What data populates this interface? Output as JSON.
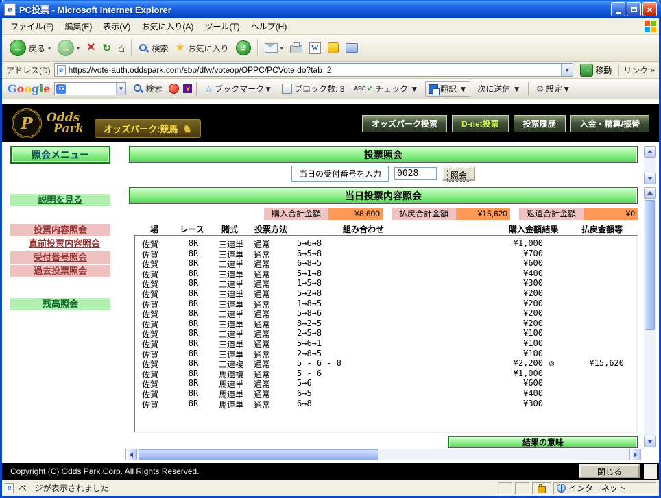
{
  "window": {
    "title": "PC投票 - Microsoft Internet Explorer"
  },
  "menubar": {
    "items": [
      "ファイル(F)",
      "編集(E)",
      "表示(V)",
      "お気に入り(A)",
      "ツール(T)",
      "ヘルプ(H)"
    ]
  },
  "toolbar": {
    "back": "戻る",
    "search": "検索",
    "favorites": "お気に入り"
  },
  "addressbar": {
    "label": "アドレス(D)",
    "url": "https://vote-auth.oddspark.com/sbp/dfw/voteop/OPPC/PCVote.do?tab=2",
    "go": "移動",
    "links": "リンク",
    "links_chevron": "»"
  },
  "googlebar": {
    "logo": "Google",
    "search": "検索",
    "bookmarks": "ブックマーク▼",
    "blocked": "ブロック数: 3",
    "check": "チェック ▼",
    "translate": "翻訳 ▼",
    "send": "次に送信 ▼",
    "settings": "設定▼"
  },
  "siteheader": {
    "brand_top": "Odds",
    "brand_bottom": "Park",
    "brand_initial": "P",
    "tagline": "オッズパーク:競馬",
    "nav": [
      "オッズパーク投票",
      "D-net投票",
      "投票履歴",
      "入金・精算/振替"
    ]
  },
  "sidebar": {
    "title": "照会メニュー",
    "help": "説明を見る",
    "links": [
      "投票内容照会",
      "直前投票内容照会",
      "受付番号照会",
      "過去投票照会"
    ],
    "balance": "残高照会"
  },
  "vote_inquiry": {
    "title": "投票照会",
    "input_label": "当日の受付番号を入力",
    "input_value": "0028",
    "submit": "照会"
  },
  "today": {
    "title": "当日投票内容照会",
    "summary": [
      {
        "label": "購入合計金額",
        "value": "¥8,600"
      },
      {
        "label": "払戻合計金額",
        "value": "¥15,620"
      },
      {
        "label": "返還合計金額",
        "value": "¥0"
      }
    ],
    "columns": [
      "場",
      "レース",
      "賭式",
      "投票方法",
      "組み合わせ",
      "購入金額",
      "結果",
      "払戻金額等"
    ],
    "rows": [
      {
        "place": "佐賀",
        "race": "8R",
        "type": "三連単",
        "method": "通常",
        "combo": "5→6→8",
        "amount": "¥1,000",
        "result": "",
        "payout": ""
      },
      {
        "place": "佐賀",
        "race": "8R",
        "type": "三連単",
        "method": "通常",
        "combo": "6→5→8",
        "amount": "¥700",
        "result": "",
        "payout": ""
      },
      {
        "place": "佐賀",
        "race": "8R",
        "type": "三連単",
        "method": "通常",
        "combo": "6→8→5",
        "amount": "¥600",
        "result": "",
        "payout": ""
      },
      {
        "place": "佐賀",
        "race": "8R",
        "type": "三連単",
        "method": "通常",
        "combo": "5→1→8",
        "amount": "¥400",
        "result": "",
        "payout": ""
      },
      {
        "place": "佐賀",
        "race": "8R",
        "type": "三連単",
        "method": "通常",
        "combo": "1→5→8",
        "amount": "¥300",
        "result": "",
        "payout": ""
      },
      {
        "place": "佐賀",
        "race": "8R",
        "type": "三連単",
        "method": "通常",
        "combo": "5→2→8",
        "amount": "¥200",
        "result": "",
        "payout": ""
      },
      {
        "place": "佐賀",
        "race": "8R",
        "type": "三連単",
        "method": "通常",
        "combo": "1→8→5",
        "amount": "¥200",
        "result": "",
        "payout": ""
      },
      {
        "place": "佐賀",
        "race": "8R",
        "type": "三連単",
        "method": "通常",
        "combo": "5→8→6",
        "amount": "¥200",
        "result": "",
        "payout": ""
      },
      {
        "place": "佐賀",
        "race": "8R",
        "type": "三連単",
        "method": "通常",
        "combo": "8→2→5",
        "amount": "¥200",
        "result": "",
        "payout": ""
      },
      {
        "place": "佐賀",
        "race": "8R",
        "type": "三連単",
        "method": "通常",
        "combo": "2→5→8",
        "amount": "¥100",
        "result": "",
        "payout": ""
      },
      {
        "place": "佐賀",
        "race": "8R",
        "type": "三連単",
        "method": "通常",
        "combo": "5→6→1",
        "amount": "¥100",
        "result": "",
        "payout": ""
      },
      {
        "place": "佐賀",
        "race": "8R",
        "type": "三連単",
        "method": "通常",
        "combo": "2→8→5",
        "amount": "¥100",
        "result": "",
        "payout": ""
      },
      {
        "place": "佐賀",
        "race": "8R",
        "type": "三連複",
        "method": "通常",
        "combo": "5 - 6 - 8",
        "amount": "¥2,200",
        "result": "◎",
        "payout": "¥15,620"
      },
      {
        "place": "佐賀",
        "race": "8R",
        "type": "馬連複",
        "method": "通常",
        "combo": "5 - 6",
        "amount": "¥1,000",
        "result": "",
        "payout": ""
      },
      {
        "place": "佐賀",
        "race": "8R",
        "type": "馬連単",
        "method": "通常",
        "combo": "5→6",
        "amount": "¥600",
        "result": "",
        "payout": ""
      },
      {
        "place": "佐賀",
        "race": "8R",
        "type": "馬連単",
        "method": "通常",
        "combo": "6→5",
        "amount": "¥400",
        "result": "",
        "payout": ""
      },
      {
        "place": "佐賀",
        "race": "8R",
        "type": "馬連単",
        "method": "通常",
        "combo": "6→8",
        "amount": "¥300",
        "result": "",
        "payout": ""
      }
    ],
    "result_legend": "結果の意味"
  },
  "footer": {
    "copyright": "Copyright (C) Odds Park Corp. All Rights Reserved.",
    "close": "閉じる"
  },
  "statusbar": {
    "message": "ページが表示されました",
    "zone": "インターネット"
  },
  "colors": {
    "title_blue": "#0c51d2",
    "header_green_border": "#128812",
    "summary_label_bg": "#f2c2c2",
    "summary_value_bg": "#ff9955",
    "link_maroon": "#993333",
    "brand_gold": "#d8b040"
  }
}
